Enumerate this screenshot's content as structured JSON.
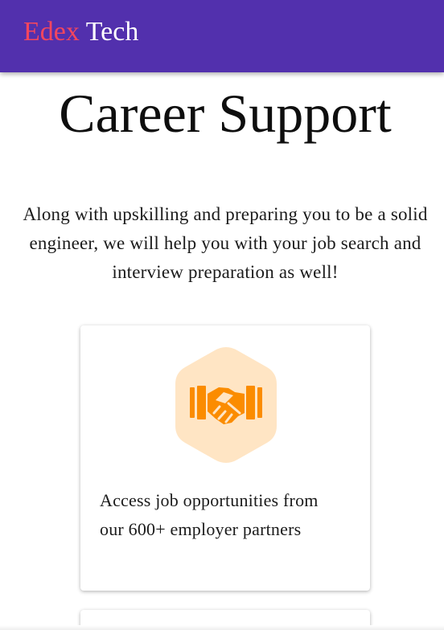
{
  "navbar": {
    "brand_first": "Edex",
    "brand_second": "Tech",
    "brand_first_color": "#f4465e",
    "background_color": "#5230ad"
  },
  "section": {
    "title": "Career Support",
    "intro": "Along with upskilling and preparing you to be a solid engineer, we will help you with your job search and interview preparation as well!"
  },
  "cards": [
    {
      "icon": "handshake-icon",
      "icon_color": "#fb8c00",
      "icon_bg_color": "#ffe5c4",
      "text": "Access job opportunities from our 600+ employer partners"
    }
  ]
}
